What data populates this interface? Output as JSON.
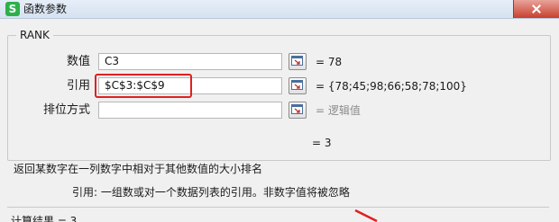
{
  "window": {
    "app_icon_letter": "S",
    "title": "函数参数",
    "close_icon": "close-icon"
  },
  "function": {
    "name": "RANK"
  },
  "arguments": [
    {
      "label": "数值",
      "value": "C3",
      "result": "= 78",
      "result_style": "normal",
      "ref_icon": "collapse-dialog-icon"
    },
    {
      "label": "引用",
      "value": "$C$3:$C$9",
      "result": "= {78;45;98;66;58;78;100}",
      "result_style": "normal",
      "ref_icon": "collapse-dialog-icon"
    },
    {
      "label": "排位方式",
      "value": "",
      "result": "= 逻辑值",
      "result_style": "grey",
      "ref_icon": "collapse-dialog-icon"
    }
  ],
  "formula_result": "= 3",
  "description": "返回某数字在一列数字中相对于其他数值的大小排名",
  "param_help": "引用:   一组数或对一个数据列表的引用。非数字值将被忽略",
  "calculation_result": "计算结果 = 3",
  "colors": {
    "highlight": "#e02020",
    "app_icon": "#2db04a"
  }
}
